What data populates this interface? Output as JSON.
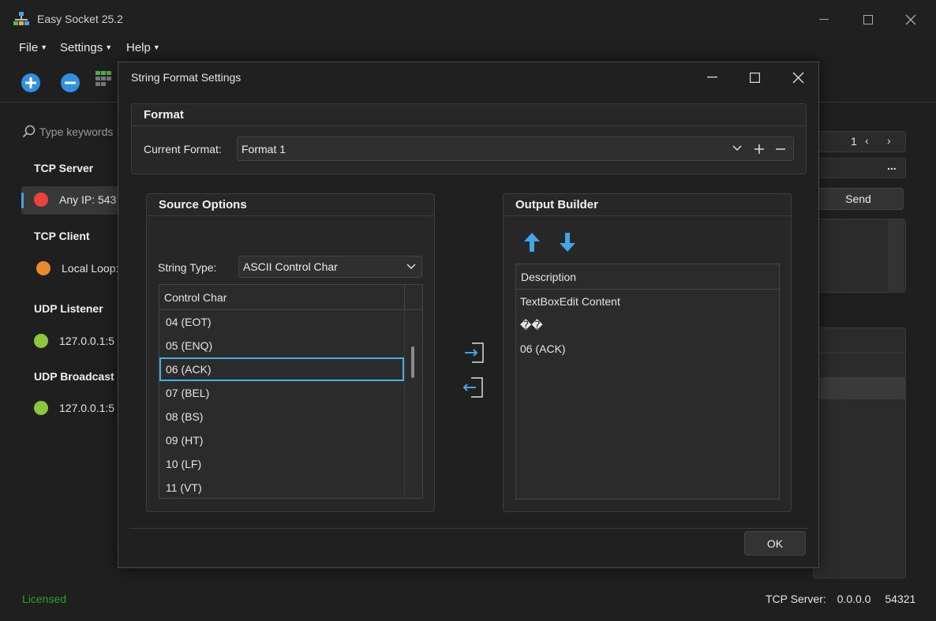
{
  "app": {
    "title": "Easy Socket 25.2",
    "menu": [
      {
        "label": "File"
      },
      {
        "label": "Settings"
      },
      {
        "label": "Help"
      }
    ]
  },
  "sidebar": {
    "search_placeholder": "Type keywords",
    "sections": [
      {
        "heading": "TCP Server",
        "items": [
          {
            "label": "Any IP: 543",
            "status": "red"
          }
        ]
      },
      {
        "heading": "TCP Client",
        "items": [
          {
            "label": "Local Loop:",
            "status": "orange"
          }
        ]
      },
      {
        "heading": "UDP Listener",
        "items": [
          {
            "label": "127.0.0.1:5",
            "status": "green"
          }
        ]
      },
      {
        "heading": "UDP Broadcast",
        "items": [
          {
            "label": "127.0.0.1:5",
            "status": "green"
          }
        ]
      }
    ]
  },
  "background": {
    "page_number": "1",
    "more_label": "...",
    "send_label": "Send"
  },
  "status": {
    "license": "Licensed",
    "server_label": "TCP Server:",
    "server_ip": "0.0.0.0",
    "server_port": "54321"
  },
  "colors": {
    "status_red": "#e8443a",
    "status_orange": "#e88a2e",
    "status_green": "#8cc63f",
    "accent": "#3fa7e8",
    "license_green": "#2e9e2e"
  },
  "dialog": {
    "title": "String Format Settings",
    "format": {
      "group_title": "Format",
      "current_label": "Current Format:",
      "current_value": "Format 1"
    },
    "source": {
      "group_title": "Source Options",
      "string_type_label": "String Type:",
      "string_type_value": "ASCII Control Char",
      "column_header": "Control Char",
      "rows": [
        "04  (EOT)",
        "05  (ENQ)",
        "06  (ACK)",
        "07  (BEL)",
        "08  (BS)",
        "09  (HT)",
        "10  (LF)",
        "11  (VT)"
      ],
      "selected_row": "06  (ACK)"
    },
    "output": {
      "group_title": "Output Builder",
      "column_header": "Description",
      "rows": [
        "TextBoxEdit Content",
        "��",
        "06 (ACK)"
      ]
    },
    "ok_label": "OK"
  }
}
